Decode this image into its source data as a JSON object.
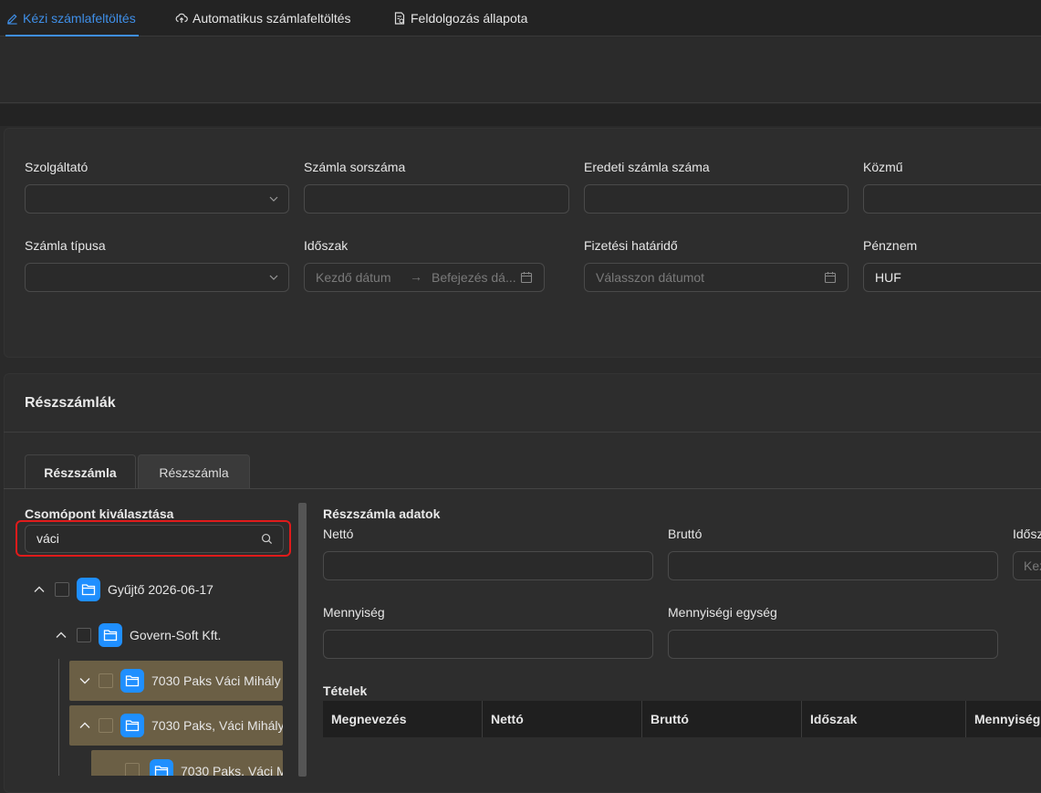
{
  "topnav": {
    "tabs": [
      {
        "label": "Kézi számlafeltöltés",
        "active": true,
        "icon": "edit-icon"
      },
      {
        "label": "Automatikus számlafeltöltés",
        "active": false,
        "icon": "cloud-upload-icon"
      },
      {
        "label": "Feldolgozás állapota",
        "active": false,
        "icon": "file-status-icon"
      }
    ]
  },
  "form": {
    "szolgaltato": {
      "label": "Szolgáltató",
      "value": ""
    },
    "szamla_sorszama": {
      "label": "Számla sorszáma",
      "value": ""
    },
    "eredeti_szamla_szama": {
      "label": "Eredeti számla száma",
      "value": ""
    },
    "kozmu": {
      "label": "Közmű",
      "value": ""
    },
    "szamla_tipusa": {
      "label": "Számla típusa",
      "value": ""
    },
    "idoszak": {
      "label": "Időszak",
      "start_placeholder": "Kezdő dátum",
      "end_placeholder": "Befejezés dá..."
    },
    "fizetesi_hatarido": {
      "label": "Fizetési határidő",
      "placeholder": "Válasszon dátumot"
    },
    "penznem": {
      "label": "Pénznem",
      "value": "HUF"
    }
  },
  "reszszamlak": {
    "title": "Részszámlák",
    "tabs": [
      {
        "label": "Részszámla",
        "active": true
      },
      {
        "label": "Részszámla",
        "active": false
      }
    ],
    "tree": {
      "title": "Csomópont kiválasztása",
      "search_value": "váci",
      "nodes": [
        {
          "label": "Gyűjtő 2026-06-17",
          "expanded": true
        },
        {
          "label": "Govern-Soft Kft.",
          "expanded": true
        },
        {
          "label": "7030 Paks Váci Mihály",
          "expanded": false
        },
        {
          "label": "7030 Paks, Váci Mihály",
          "expanded": true
        },
        {
          "label": "7030 Paks, Váci M"
        }
      ]
    },
    "details": {
      "title": "Részszámla adatok",
      "netto": {
        "label": "Nettó",
        "value": ""
      },
      "brutto": {
        "label": "Bruttó",
        "value": ""
      },
      "idoszak": {
        "label": "Idősz",
        "placeholder": "Kez"
      },
      "mennyiseg": {
        "label": "Mennyiség",
        "value": ""
      },
      "mennyisegi_egyseg": {
        "label": "Mennyiségi egység",
        "value": ""
      }
    },
    "items": {
      "title": "Tételek",
      "columns": [
        "Megnevezés",
        "Nettó",
        "Bruttó",
        "Időszak",
        "Mennyiség"
      ]
    }
  },
  "colors": {
    "accent": "#3f8fe8",
    "folder": "#1f8fff",
    "highlight_row": "#6b5f45",
    "search_outline": "#e01b1b"
  }
}
